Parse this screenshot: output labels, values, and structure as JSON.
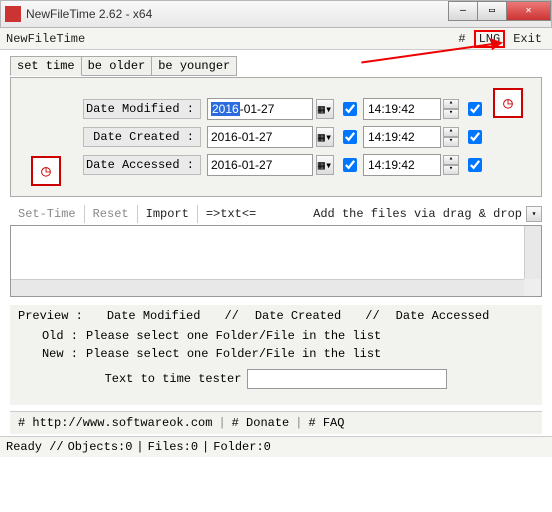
{
  "window": {
    "title": "NewFileTime 2.62 - x64"
  },
  "menubar": {
    "appname": "NewFileTime",
    "hash": "#",
    "lng": "LNG",
    "exit": "Exit"
  },
  "tabs": {
    "set_time": "set time",
    "be_older": "be older",
    "be_younger": "be younger"
  },
  "fields": {
    "modified": {
      "label": "Date Modified :",
      "year": "2016",
      "rest": "-01-27",
      "time": "14:19:42"
    },
    "created": {
      "label": "Date Created :",
      "date": "2016-01-27",
      "time": "14:19:42"
    },
    "accessed": {
      "label": "Date Accessed :",
      "date": "2016-01-27",
      "time": "14:19:42"
    }
  },
  "toolbar": {
    "set_time": "Set-Time",
    "reset": "Reset",
    "import": "Import",
    "txt": "=>txt<=",
    "drag_label": "Add the files via drag & drop"
  },
  "preview": {
    "header": {
      "preview": "Preview  :",
      "dm": "Date Modified",
      "s": "//",
      "dc": "Date Created",
      "da": "Date Accessed"
    },
    "old_label": "Old :",
    "new_label": "New :",
    "select_msg": "Please select one Folder/File in the list"
  },
  "tester": {
    "label": "Text to time tester",
    "value": ""
  },
  "footer": {
    "url": "# http://www.softwareok.com",
    "donate": "# Donate",
    "faq": "# FAQ"
  },
  "status": {
    "ready": "Ready //",
    "objects": "Objects:0",
    "files": "Files:0",
    "folder": "Folder:0"
  },
  "glyph": {
    "down": "▾",
    "up": "▴",
    "cal": "▦",
    "x": "✕",
    "min": "—",
    "max": "▭",
    "clock": "◷"
  }
}
